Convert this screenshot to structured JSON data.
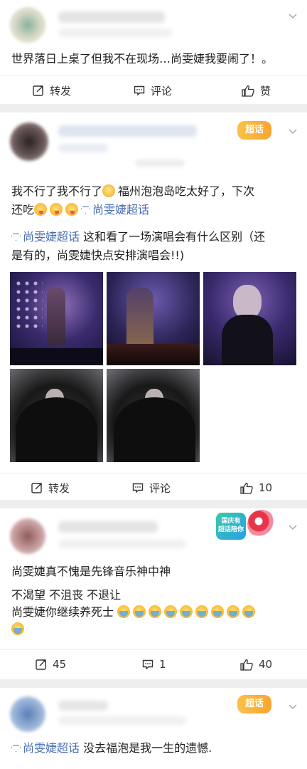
{
  "posts": [
    {
      "text": "世界落日上桌了但我不在现场…尚雯婕我要闹了！。",
      "actions": {
        "repost": "转发",
        "comment": "评论",
        "like": "赞"
      }
    },
    {
      "badge": "超话",
      "text_line1_a": "我不行了我不行了",
      "text_line1_b": "福州泡泡岛吃太好了，下次",
      "text_line2_a": "还吃",
      "topic": "尚雯婕超话",
      "text_line3_b": "这和看了一场演唱会有什么区别（还",
      "text_line4": "是有的，尚雯婕快点安排演唱会!!)",
      "actions": {
        "repost": "转发",
        "comment": "评论",
        "like": "10"
      }
    },
    {
      "badge_lines": [
        "国庆有",
        "超话陪你"
      ],
      "text_line1": "尚雯婕真不愧是先锋音乐神中神",
      "text_line2": "不渴望 不沮丧 不退让",
      "text_line3": "尚雯婕你继续养死士",
      "actions": {
        "repost": "45",
        "comment": "1",
        "like": "40"
      }
    },
    {
      "badge": "超话",
      "topic": "尚雯婕超话",
      "text": "没去福泡是我一生的遗憾."
    }
  ],
  "icons": {
    "repost": "repost-icon",
    "comment": "comment-icon",
    "like": "thumbs-up-icon",
    "menu": "chevron-down-icon",
    "topic": "diamond-icon"
  },
  "colors": {
    "topic": "#4a6fb5",
    "badge": "#f7a530",
    "background": "#f2f2f2"
  }
}
